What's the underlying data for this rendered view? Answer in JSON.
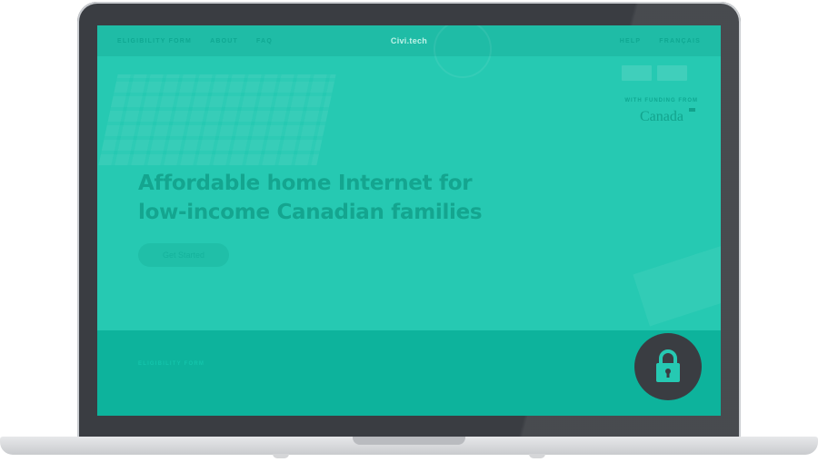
{
  "nav": {
    "left": [
      "ELIGIBILITY FORM",
      "ABOUT",
      "FAQ"
    ],
    "brand": "Civi.tech",
    "right": [
      "HELP",
      "FRANÇAIS"
    ]
  },
  "hero": {
    "title_line1": "Affordable home Internet for",
    "title_line2": "low-income Canadian families",
    "cta_label": "Get Started"
  },
  "funding": {
    "label": "WITH FUNDING FROM",
    "wordmark": "Canada"
  },
  "lower": {
    "label": "ELIGIBILITY FORM"
  },
  "badge": {
    "icon": "lock-icon"
  },
  "colors": {
    "screen_teal": "#26c9b2",
    "nav_teal": "#1fbca6",
    "band_teal": "#0db39c",
    "text_teal": "#14a58f",
    "laptop_dark": "#3a3d42"
  }
}
